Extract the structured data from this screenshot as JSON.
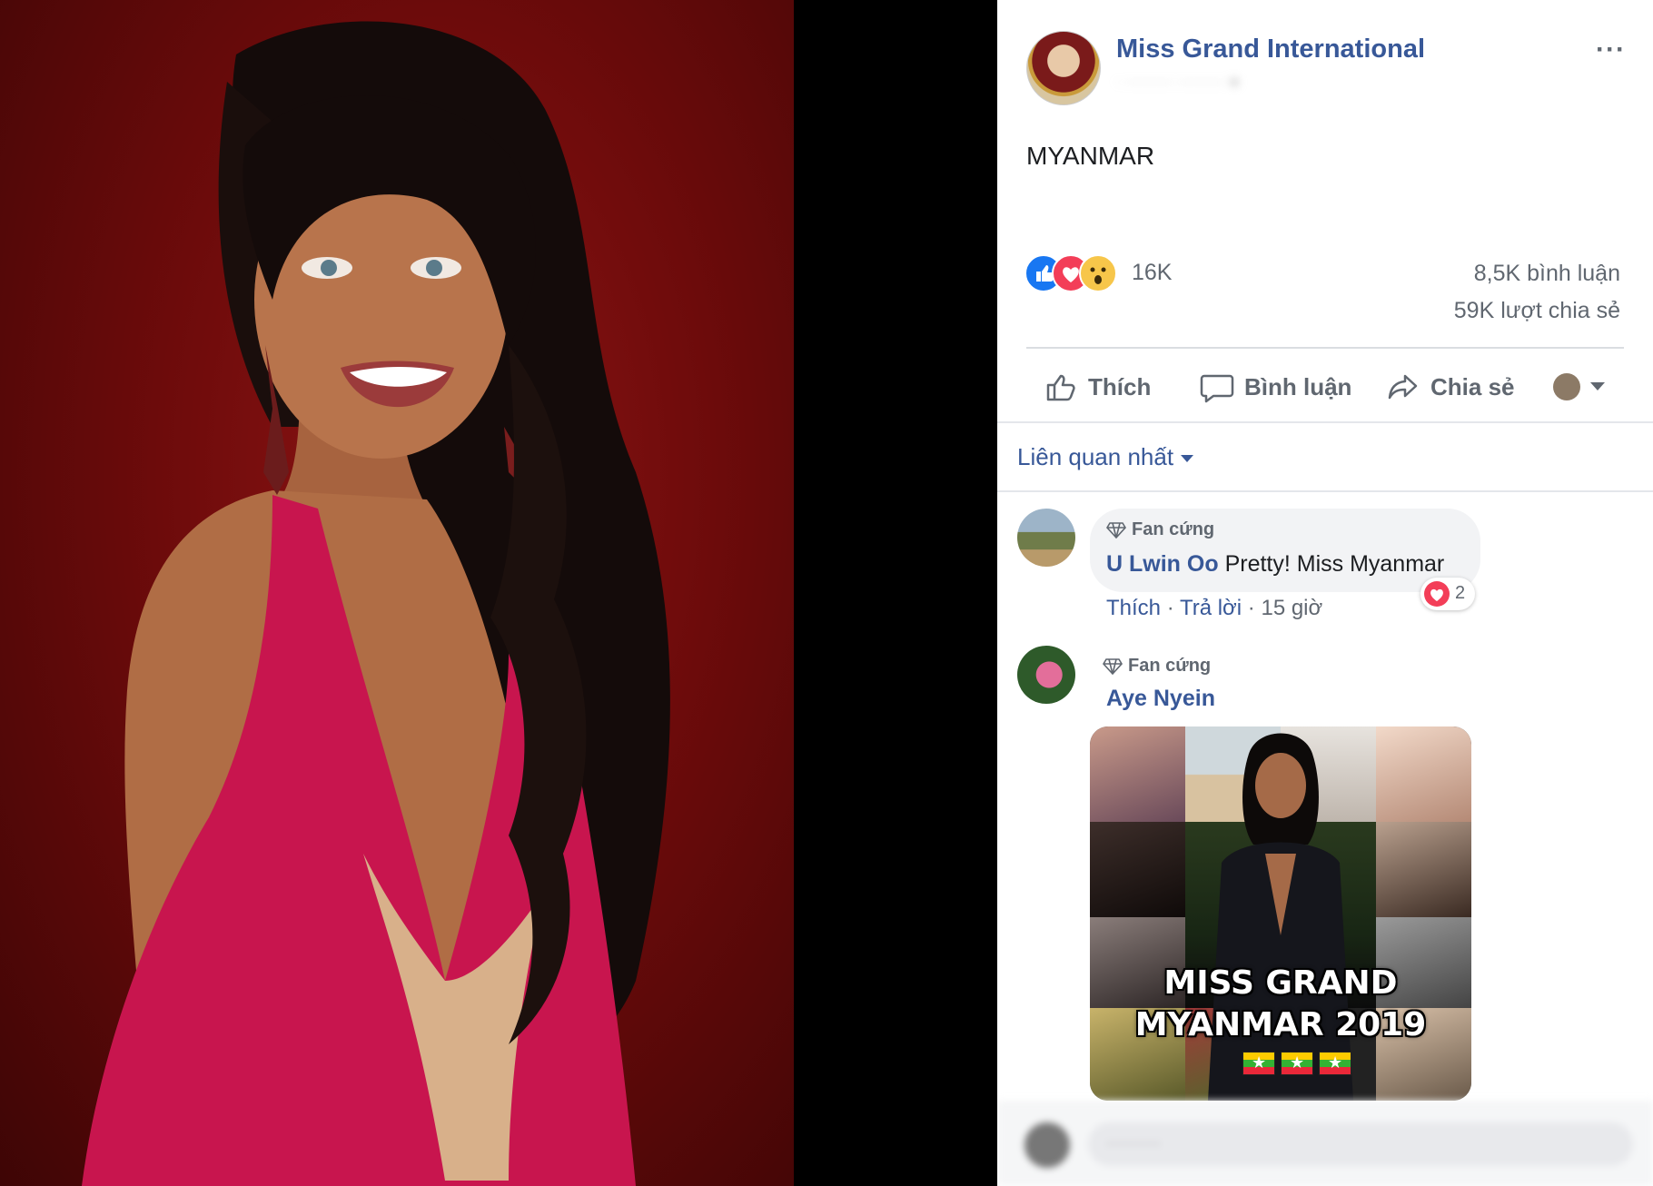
{
  "post": {
    "page_name": "Miss Grand International",
    "more_icon": "···",
    "text": "MYANMAR",
    "reaction_count": "16K",
    "comments_count": "8,5K bình luận",
    "shares_count": "59K lượt chia sẻ"
  },
  "actions": {
    "like": "Thích",
    "comment": "Bình luận",
    "share": "Chia sẻ"
  },
  "sort_label": "Liên quan nhất",
  "comments": [
    {
      "badge": "Fan cứng",
      "author": "U Lwin Oo",
      "text": "Pretty! Miss Myanmar",
      "reaction_count": "2",
      "like_link": "Thích",
      "reply_link": "Trả lời",
      "time": "15 giờ",
      "sep": "·"
    },
    {
      "badge": "Fan cứng",
      "author": "Aye Nyein",
      "image_caption_line1": "MISS GRAND",
      "image_caption_line2": "MYANMAR 2019"
    }
  ],
  "colors": {
    "link": "#385898",
    "muted": "#606770",
    "photo_bg": "#7a0e0e",
    "dress": "#c8154e"
  }
}
